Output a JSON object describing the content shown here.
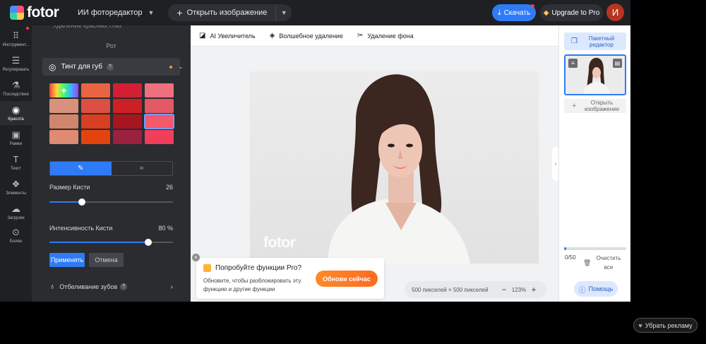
{
  "topbar": {
    "logo_text": "fotor",
    "ai_editor_label": "ИИ фотоpедактор",
    "open_image_label": "Открыть изображение",
    "download_label": "Скачать",
    "upgrade_label": "Upgrade to Pro",
    "avatar_initial": "И"
  },
  "rail": {
    "items": [
      {
        "label": "Инструмент...",
        "icon": "grid-icon"
      },
      {
        "label": "Регулировать",
        "icon": "sliders-icon"
      },
      {
        "label": "Последствия",
        "icon": "flask-icon"
      },
      {
        "label": "Красота",
        "icon": "eye-icon"
      },
      {
        "label": "Рамки",
        "icon": "frame-icon"
      },
      {
        "label": "Текст",
        "icon": "text-icon"
      },
      {
        "label": "Элементы",
        "icon": "elements-icon"
      },
      {
        "label": "Загрузки",
        "icon": "upload-cloud-icon"
      },
      {
        "label": "Более",
        "icon": "more-icon"
      }
    ]
  },
  "panel": {
    "cut_text": "Удаление красных глаз",
    "section_title": "Рот",
    "lip_tint_label": "Тинт для губ",
    "swatches": [
      "#e96442",
      "#d21f34",
      "#ee6f7d",
      "#d8927c",
      "#db5042",
      "#cb2125",
      "#e35a66",
      "#d0856f",
      "#d63f22",
      "#a71620",
      "#f5576b",
      "#df8a72",
      "#e3440e",
      "#9c2042",
      "#ef3f5c"
    ],
    "brush_size_label": "Размер Кисти",
    "brush_size_value": "26",
    "brush_size_fraction": 0.26,
    "intensity_label": "Интенсивность Кисти",
    "intensity_value": "80 %",
    "intensity_fraction": 0.8,
    "apply_label": "Применять",
    "cancel_label": "Отмена",
    "teeth_label": "Отбеливание зубов"
  },
  "canvas": {
    "tools": [
      {
        "label": "AI Увеличитель",
        "icon": "ai-upscale-icon"
      },
      {
        "label": "Волшебное удаление",
        "icon": "eraser-icon"
      },
      {
        "label": "Удаление фона",
        "icon": "scissors-icon"
      }
    ],
    "watermark": "fotor",
    "dimensions": "500 пикселей × 500 пикселей",
    "zoom": "123%"
  },
  "promo": {
    "title": "Попробуйте функции Pro?",
    "description": "Обновите, чтобы разблокировать эту функцию и другие функции",
    "button_label": "Обнови сейчас"
  },
  "rpanel": {
    "batch_label": "Пакетный редактор",
    "open_label": "Открыть изображение",
    "count": "0/50",
    "clear_label": "Очистить все",
    "help_label": "Помощь"
  },
  "footer": {
    "remove_ads_label": "Убрать рекламу"
  }
}
